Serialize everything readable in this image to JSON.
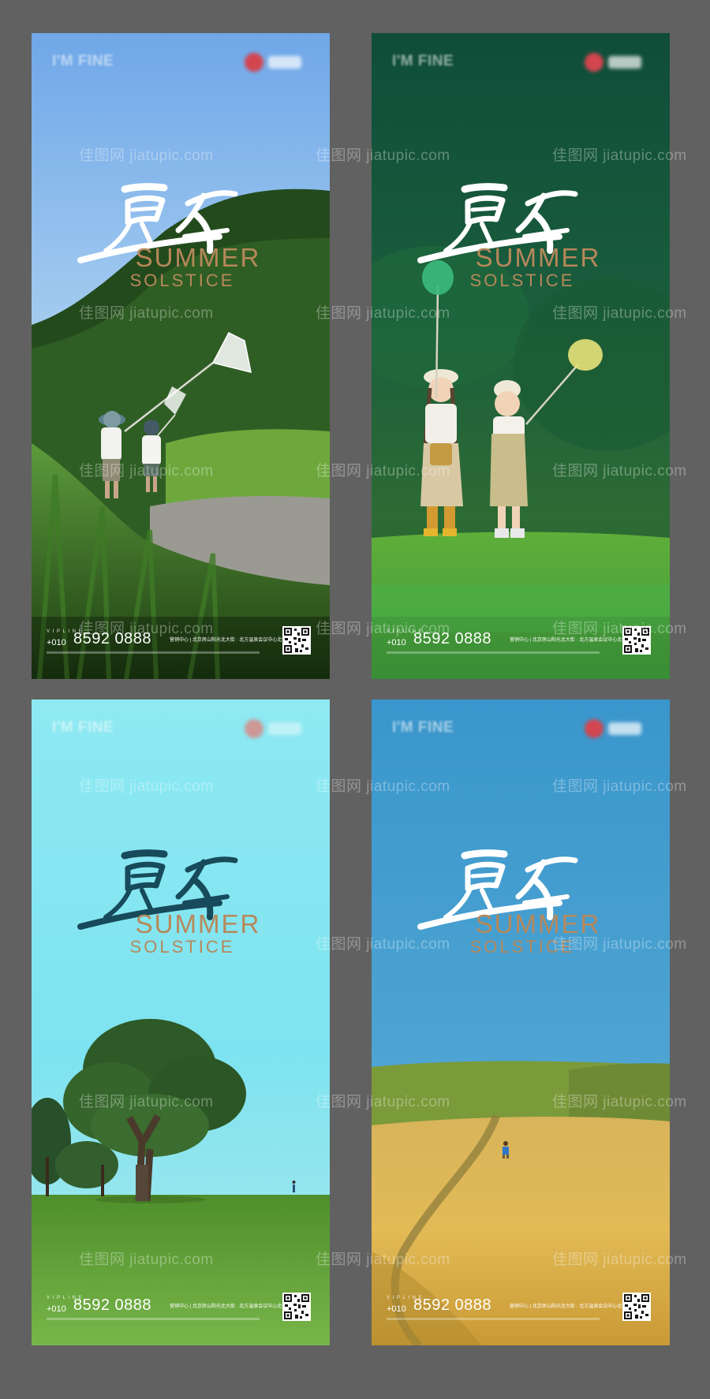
{
  "posters": [
    {
      "brand": "I'M FINE",
      "title_cn": "夏至",
      "title_en_1": "SUMMER",
      "title_en_2": "SOLSTICE",
      "vip_label": "V I P  L I N E",
      "area_code": "+010",
      "phone": "8592 0888",
      "address": "营销中心 | 北京房山阳光北大街 · 北方温泉会议中心北侧",
      "calligraphy_color": "#ffffff"
    },
    {
      "brand": "I'M FINE",
      "title_cn": "夏至",
      "title_en_1": "SUMMER",
      "title_en_2": "SOLSTICE",
      "vip_label": "V I P  L I N E",
      "area_code": "+010",
      "phone": "8592 0888",
      "address": "营销中心 | 北京房山阳光北大街 · 北方温泉会议中心北侧",
      "calligraphy_color": "#ffffff"
    },
    {
      "brand": "I'M FINE",
      "title_cn": "夏至",
      "title_en_1": "SUMMER",
      "title_en_2": "SOLSTICE",
      "vip_label": "V I P  L I N E",
      "area_code": "+010",
      "phone": "8592 0888",
      "address": "营销中心 | 北京房山阳光北大街 · 北方温泉会议中心北侧",
      "calligraphy_color": "#174a5a"
    },
    {
      "brand": "I'M FINE",
      "title_cn": "夏至",
      "title_en_1": "SUMMER",
      "title_en_2": "SOLSTICE",
      "vip_label": "V I P  L I N E",
      "area_code": "+010",
      "phone": "8592 0888",
      "address": "营销中心 | 北京房山阳光北大街 · 北方温泉会议中心北侧",
      "calligraphy_color": "#ffffff"
    }
  ],
  "watermark": "佳图网 jiatupic.com",
  "colors": {
    "canvas": "#616161",
    "title_en": "#b7885a"
  }
}
